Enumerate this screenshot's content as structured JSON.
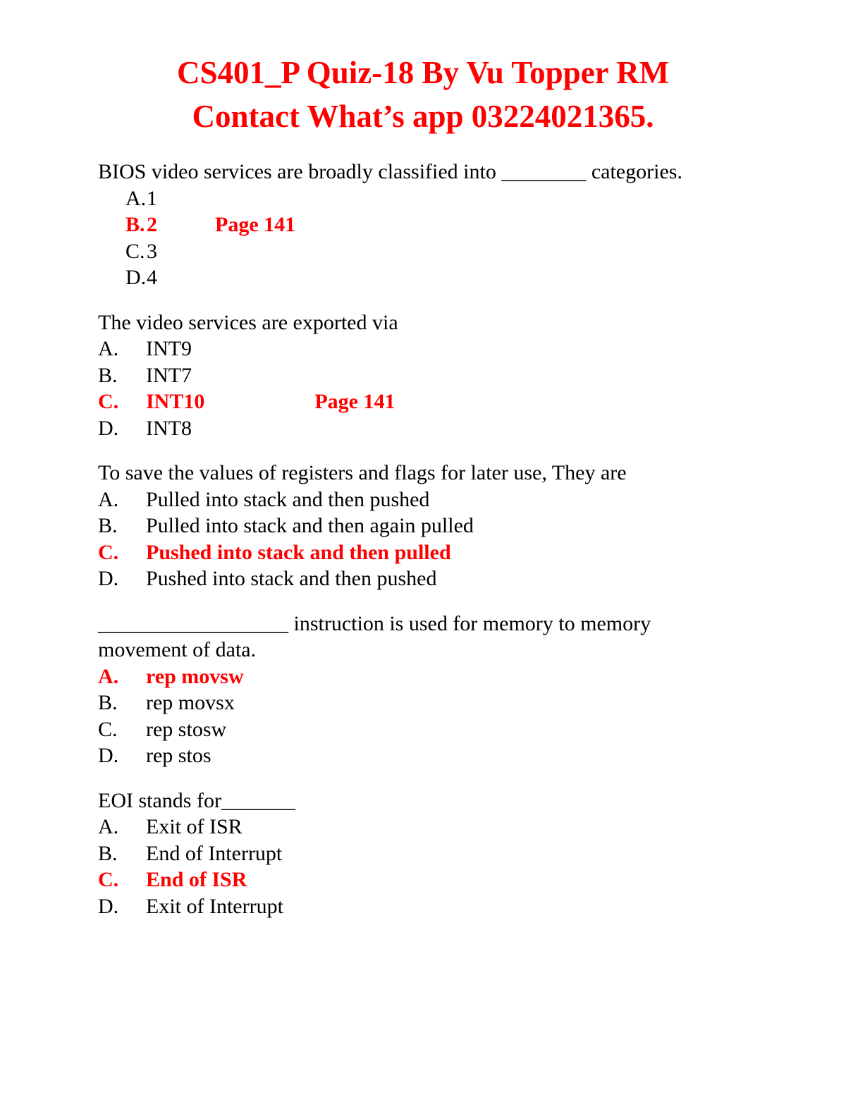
{
  "document": {
    "title_lines": [
      "CS401_P Quiz-18 By Vu Topper RM",
      "Contact What’s app 03224021365."
    ],
    "title_color": "#FF0000",
    "body_color": "#000000",
    "answer_color": "#FF0000"
  },
  "questions": [
    {
      "stem": "BIOS video services are broadly classified into ________ categories.",
      "options": [
        {
          "letter": "A.",
          "text": "1",
          "note": "",
          "correct": false
        },
        {
          "letter": "B.",
          "text": "2",
          "note": "Page 141",
          "correct": true
        },
        {
          "letter": "C.",
          "text": "3",
          "note": "",
          "correct": false
        },
        {
          "letter": "D.",
          "text": "4",
          "note": "",
          "correct": false
        }
      ]
    },
    {
      "stem": "The video services are exported via",
      "options": [
        {
          "letter": "A.",
          "text": "INT9",
          "note": "",
          "correct": false
        },
        {
          "letter": "B.",
          "text": "INT7",
          "note": "",
          "correct": false
        },
        {
          "letter": "C.",
          "text": "INT10",
          "note": "Page 141",
          "correct": true
        },
        {
          "letter": "D.",
          "text": "INT8",
          "note": "",
          "correct": false
        }
      ]
    },
    {
      "stem": "To save the values of registers and flags for later use, They are",
      "options": [
        {
          "letter": "A.",
          "text": "Pulled into stack and then pushed",
          "note": "",
          "correct": false
        },
        {
          "letter": "B.",
          "text": "Pulled into stack and then again pulled",
          "note": "",
          "correct": false
        },
        {
          "letter": "C.",
          "text": "Pushed into stack and then pulled",
          "note": "",
          "correct": true
        },
        {
          "letter": "D.",
          "text": "Pushed into stack and then pushed",
          "note": "",
          "correct": false
        }
      ]
    },
    {
      "stem": "__________________ instruction is used for memory to memory\nmovement of data.",
      "options": [
        {
          "letter": "A.",
          "text": "rep movsw",
          "note": "",
          "correct": true
        },
        {
          "letter": "B.",
          "text": "rep movsx",
          "note": "",
          "correct": false
        },
        {
          "letter": "C.",
          "text": "rep stosw",
          "note": "",
          "correct": false
        },
        {
          "letter": "D.",
          "text": "rep stos",
          "note": "",
          "correct": false
        }
      ]
    },
    {
      "stem": "EOI stands for_______",
      "options": [
        {
          "letter": "A.",
          "text": "Exit of ISR",
          "note": "",
          "correct": false
        },
        {
          "letter": "B.",
          "text": "End of Interrupt",
          "note": "",
          "correct": false
        },
        {
          "letter": "C.",
          "text": "End of ISR",
          "note": "",
          "correct": true
        },
        {
          "letter": "D.",
          "text": "Exit of Interrupt",
          "note": "",
          "correct": false
        }
      ]
    }
  ]
}
